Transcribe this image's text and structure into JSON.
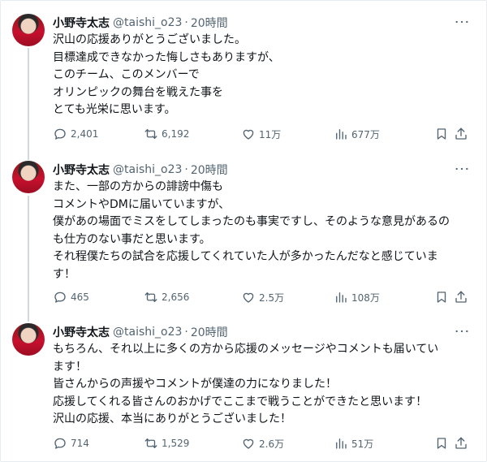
{
  "tweets": [
    {
      "name": "小野寺太志",
      "handle": "@taishi_o23",
      "separator": "·",
      "time": "20時間",
      "lines": [
        "沢山の応援ありがとうございました。",
        "目標達成できなかった悔しさもありますが、",
        "このチーム、このメンバーで",
        "オリンピックの舞台を戦えた事を",
        "とても光栄に思います。"
      ],
      "replies": "2,401",
      "retweets": "6,192",
      "likes": "11万",
      "views": "677万"
    },
    {
      "name": "小野寺太志",
      "handle": "@taishi_o23",
      "separator": "·",
      "time": "20時間",
      "lines": [
        "また、一部の方からの誹謗中傷も",
        "コメントやDMに届いていますが、",
        "僕があの場面でミスをしてしまったのも事実ですし、そのような意見があるの",
        "も仕方のない事だと思います。",
        "それ程僕たちの試合を応援してくれていた人が多かったんだなと感じていま",
        "す！"
      ],
      "replies": "465",
      "retweets": "2,656",
      "likes": "2.5万",
      "views": "108万"
    },
    {
      "name": "小野寺太志",
      "handle": "@taishi_o23",
      "separator": "·",
      "time": "20時間",
      "lines": [
        "もちろん、それ以上に多くの方から応援のメッセージやコメントも届いてい",
        "ます！",
        "皆さんからの声援やコメントが僕達の力になりました！",
        "応援してくれる皆さんのおかげでここまで戦うことができたと思います！",
        "沢山の応援、本当にありがとうございました！"
      ],
      "replies": "714",
      "retweets": "1,529",
      "likes": "2.6万",
      "views": "51万"
    }
  ],
  "icons": {
    "reply": "reply-icon",
    "retweet": "retweet-icon",
    "like": "heart-icon",
    "views": "bar-chart-icon",
    "bookmark": "bookmark-icon",
    "share": "share-icon",
    "more": "more-horizontal-icon"
  }
}
